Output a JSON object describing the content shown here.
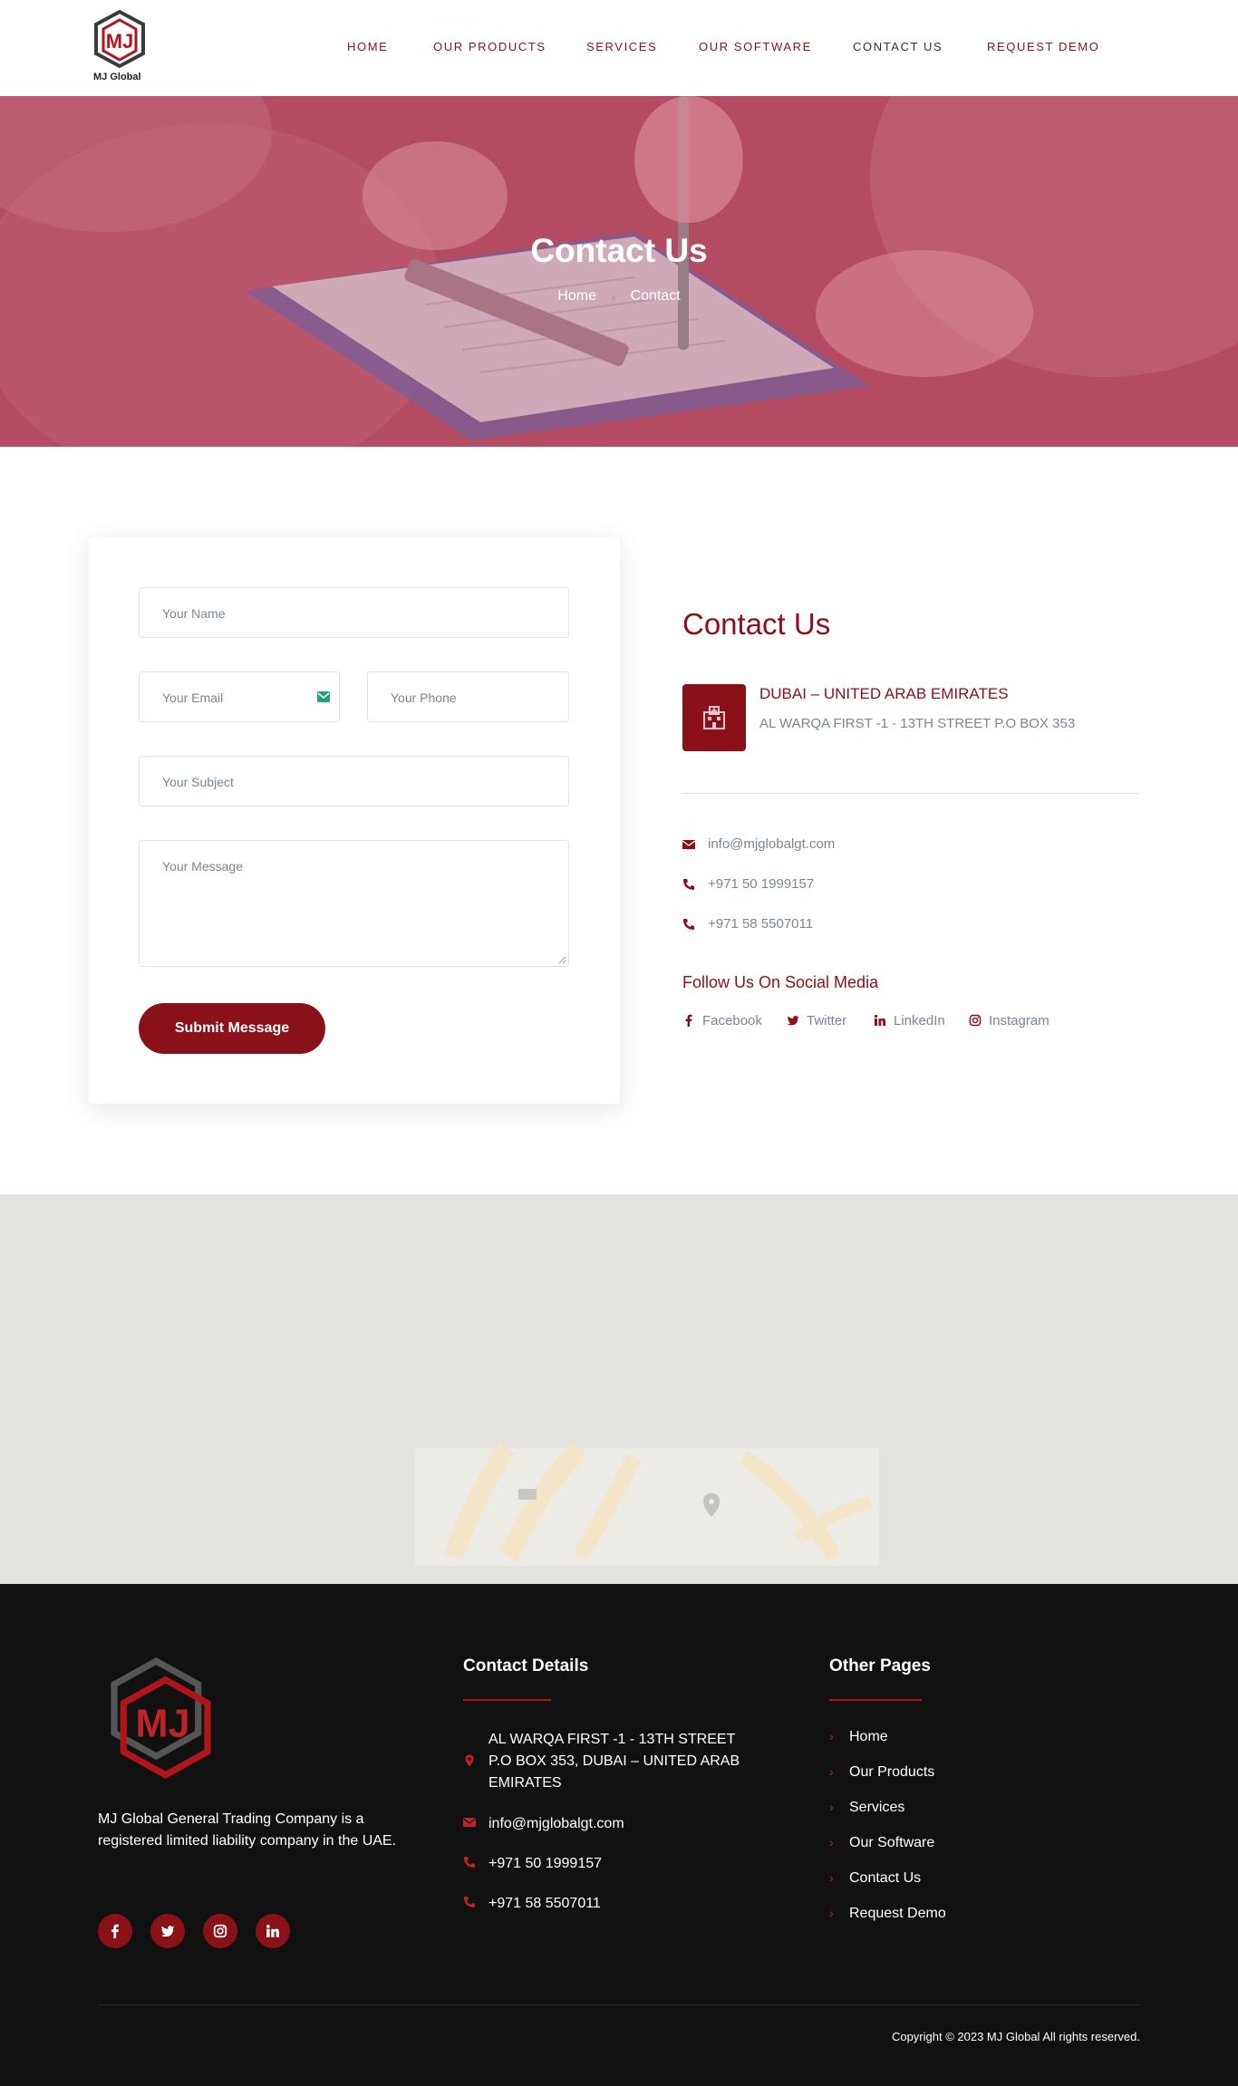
{
  "header": {
    "logo_text": "MJ Global",
    "nav": [
      {
        "label": "HOME"
      },
      {
        "label": "OUR PRODUCTS"
      },
      {
        "label": "SERVICES"
      },
      {
        "label": "OUR SOFTWARE"
      },
      {
        "label": "CONTACT US"
      },
      {
        "label": "REQUEST DEMO"
      }
    ],
    "active_nav": "CONTACT US"
  },
  "hero": {
    "title": "Contact Us",
    "breadcrumb": [
      "Home",
      "Contact"
    ]
  },
  "form": {
    "name_placeholder": "Your Name",
    "email_placeholder": "Your Email",
    "phone_placeholder": "Your Phone",
    "subject_placeholder": "Your Subject",
    "message_placeholder": "Your Message",
    "submit_label": "Submit Message"
  },
  "contact_info": {
    "title": "Contact Us",
    "location_heading": "DUBAI – UNITED ARAB EMIRATES",
    "address": "AL WARQA FIRST -1 - 13TH STREET P.O BOX 353",
    "email": "info@mjglobalgt.com",
    "phone_1": "+971 50 1999157",
    "phone_2": "+971 58 5507011",
    "follow_heading": "Follow Us On Social Media",
    "socials": [
      "Facebook",
      "Twitter",
      "LinkedIn",
      "Instagram"
    ]
  },
  "footer": {
    "description": "MJ Global General Trading Company is a registered limited liability company in the UAE.",
    "contact_heading": "Contact Details",
    "address": "AL WARQA FIRST -1 - 13TH STREET P.O BOX 353, DUBAI – UNITED ARAB EMIRATES",
    "email": "info@mjglobalgt.com",
    "phone_1": "+971 50 1999157",
    "phone_2": "+971 58 5507011",
    "pages_heading": "Other Pages",
    "pages": [
      "Home",
      "Our Products",
      "Services",
      "Our Software",
      "Contact Us",
      "Request Demo"
    ],
    "copyright": "Copyright © 2023  MJ Global All rights reserved."
  },
  "colors": {
    "brand": "#8b1118",
    "hero_overlay": "#b5485e",
    "footer_bg": "#111111",
    "muted_text": "#7a8694"
  },
  "icons": [
    "mj-logo-icon",
    "envelope-icon",
    "phone-icon",
    "map-pin-icon",
    "building-icon",
    "facebook-icon",
    "twitter-icon",
    "linkedin-icon",
    "instagram-icon",
    "chevron-right-icon"
  ]
}
